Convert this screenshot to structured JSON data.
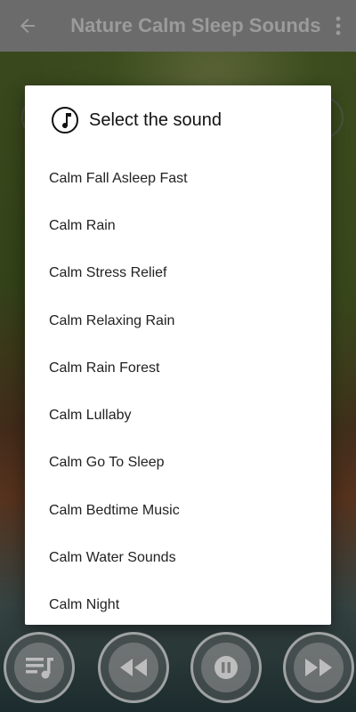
{
  "app_bar": {
    "title": "Nature Calm Sleep Sounds",
    "back_icon": "arrow-left-icon",
    "menu_icon": "more-vert-icon"
  },
  "dialog": {
    "title": "Select the sound",
    "icon": "music-note-icon",
    "items": [
      "Calm Fall Asleep Fast",
      "Calm Rain",
      "Calm Stress Relief",
      "Calm Relaxing Rain",
      "Calm Rain Forest",
      "Calm Lullaby",
      "Calm Go To Sleep",
      "Calm Bedtime Music",
      "Calm Water Sounds",
      "Calm Night"
    ]
  },
  "controls": {
    "playlist_icon": "playlist-music-icon",
    "rewind_icon": "rewind-icon",
    "pause_icon": "pause-icon",
    "forward_icon": "fast-forward-icon"
  },
  "colors": {
    "app_bar": "#6b6b6b",
    "dialog_bg": "#ffffff",
    "text": "#222222"
  }
}
